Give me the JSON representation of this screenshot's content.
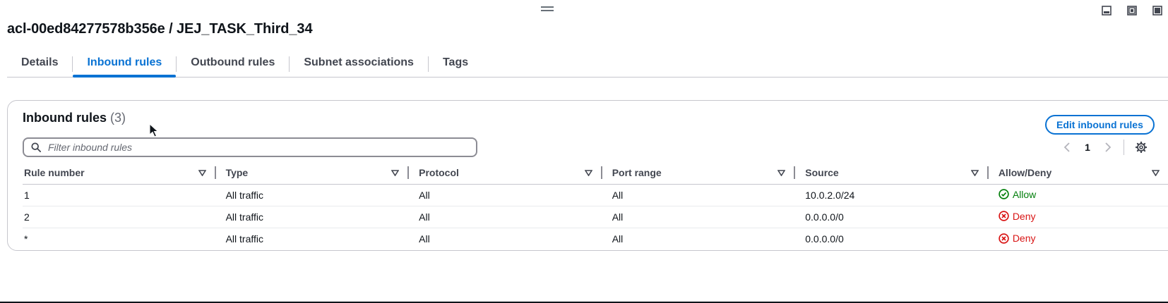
{
  "page": {
    "title": "acl-00ed84277578b356e / JEJ_TASK_Third_34"
  },
  "tabs": [
    {
      "label": "Details",
      "active": false
    },
    {
      "label": "Inbound rules",
      "active": true
    },
    {
      "label": "Outbound rules",
      "active": false
    },
    {
      "label": "Subnet associations",
      "active": false
    },
    {
      "label": "Tags",
      "active": false
    }
  ],
  "panel": {
    "title": "Inbound rules",
    "count": "(3)",
    "edit_button": "Edit inbound rules",
    "filter_placeholder": "Filter inbound rules",
    "filter_value": "",
    "pagination": {
      "current_page": "1"
    }
  },
  "table": {
    "columns": [
      "Rule number",
      "Type",
      "Protocol",
      "Port range",
      "Source",
      "Allow/Deny"
    ],
    "rows": [
      {
        "rule_number": "1",
        "type": "All traffic",
        "protocol": "All",
        "port_range": "All",
        "source": "10.0.2.0/24",
        "action": "Allow"
      },
      {
        "rule_number": "2",
        "type": "All traffic",
        "protocol": "All",
        "port_range": "All",
        "source": "0.0.0.0/0",
        "action": "Deny"
      },
      {
        "rule_number": "*",
        "type": "All traffic",
        "protocol": "All",
        "port_range": "All",
        "source": "0.0.0.0/0",
        "action": "Deny"
      }
    ]
  },
  "colors": {
    "accent": "#0972d3",
    "allow": "#037f0c",
    "deny": "#d91515",
    "text": "#0f141a",
    "muted": "#656871"
  },
  "icons": [
    "drag-handle-icon",
    "panel-bottom-icon",
    "panel-split-icon",
    "panel-fullscreen-icon",
    "search-icon",
    "chevron-left-icon",
    "chevron-right-icon",
    "gear-icon",
    "sort-icon",
    "check-circle-icon",
    "x-circle-icon",
    "mouse-cursor-icon"
  ]
}
